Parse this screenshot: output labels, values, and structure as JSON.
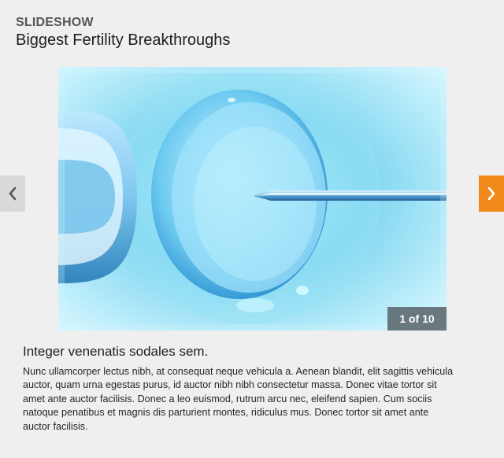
{
  "header": {
    "eyebrow": "SLIDESHOW",
    "title": "Biggest Fertility Breakthroughs"
  },
  "slide": {
    "counter": "1 of 10",
    "caption_title": "Integer venenatis sodales sem.",
    "caption_body": "Nunc ullamcorper lectus nibh, at consequat neque vehicula a. Aenean blandit, elit sagittis vehicula auctor, quam urna egestas purus, id auctor nibh nibh consectetur massa. Donec vitae tortor sit amet ante auctor facilisis. Donec a leo euismod, rutrum arcu nec, eleifend sapien. Cum sociis natoque penatibus et magnis dis parturient montes, ridiculus mus. Donec tortor sit amet ante auctor facilisis."
  },
  "navigation": {
    "prev_icon": "chevron-left-icon",
    "next_icon": "chevron-right-icon"
  },
  "colors": {
    "background": "#efefef",
    "next_button": "#f28a1b",
    "prev_button": "#d9d9d9",
    "counter_bg": "#5f6e73"
  }
}
